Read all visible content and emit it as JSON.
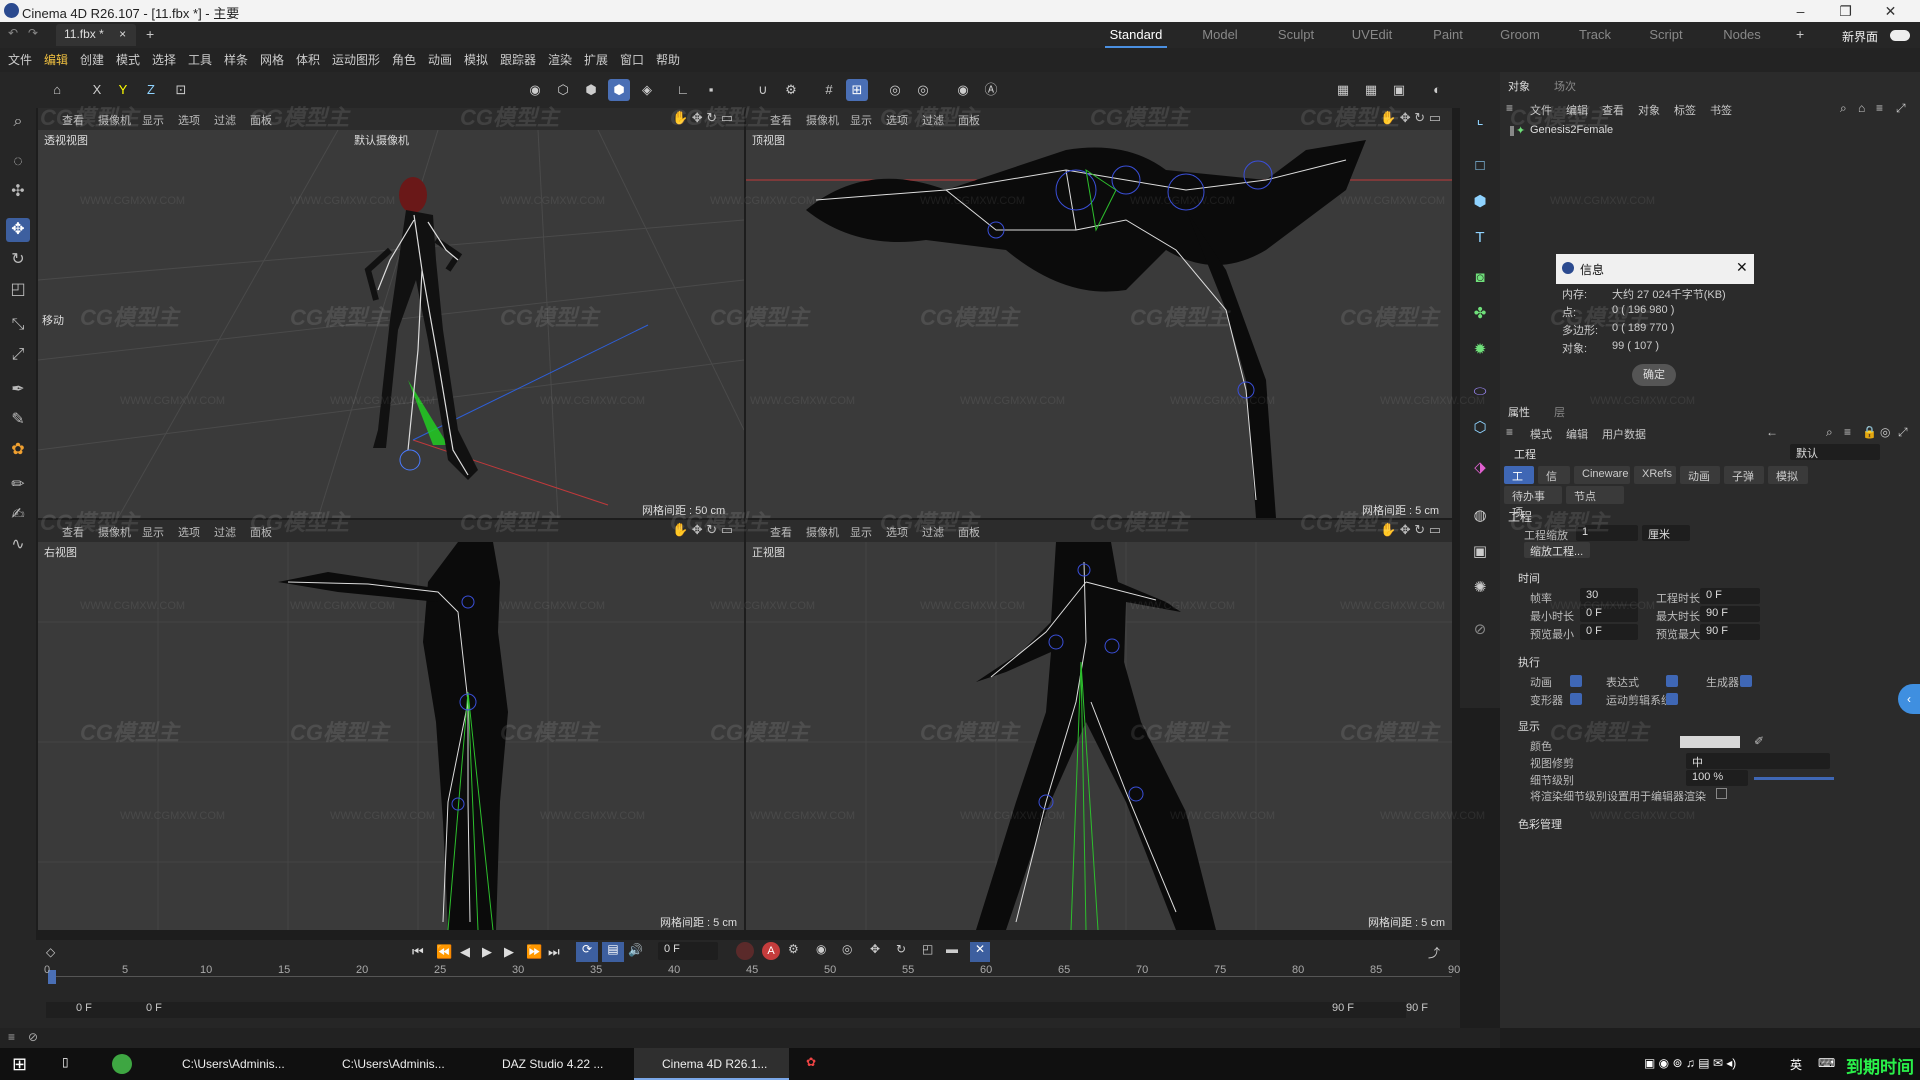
{
  "window": {
    "title": "Cinema 4D R26.107 - [11.fbx *] - 主要"
  },
  "doc_tab": {
    "label": "11.fbx *",
    "close": "×",
    "add": "+"
  },
  "layouts": [
    "Standard",
    "Model",
    "Sculpt",
    "UVEdit",
    "Paint",
    "Groom",
    "Track",
    "Script",
    "Nodes"
  ],
  "layout_active": "Standard",
  "layout_add": "+",
  "new_ui": "新界面",
  "menu": [
    "文件",
    "编辑",
    "创建",
    "模式",
    "选择",
    "工具",
    "样条",
    "网格",
    "体积",
    "运动图形",
    "角色",
    "动画",
    "模拟",
    "跟踪器",
    "渲染",
    "扩展",
    "窗口",
    "帮助"
  ],
  "toolbar_axes": [
    "X",
    "Y",
    "Z"
  ],
  "viewport_menu": [
    "查看",
    "摄像机",
    "显示",
    "选项",
    "过滤",
    "面板"
  ],
  "viewports": {
    "tl": {
      "name": "透视视图",
      "camera": "默认摄像机",
      "grid": "网格间距 : 50 cm",
      "move_label": "移动"
    },
    "tr": {
      "name": "顶视图",
      "grid": "网格间距 : 5 cm"
    },
    "bl": {
      "name": "右视图",
      "grid": "网格间距 : 5 cm"
    },
    "br": {
      "name": "正视图",
      "grid": "网格间距 : 5 cm"
    }
  },
  "watermark": {
    "logo": "CG模型主",
    "url": "WWW.CGMXW.COM"
  },
  "object_panel": {
    "tabs": [
      "对象",
      "场次"
    ],
    "menu": [
      "文件",
      "编辑",
      "查看",
      "对象",
      "标签",
      "书签"
    ],
    "object_name": "Genesis2Female"
  },
  "info_dialog": {
    "title": "信息",
    "rows": [
      {
        "label": "内存:",
        "value": "大约 27 024千字节(KB)"
      },
      {
        "label": "点:",
        "value": "0 ( 196 980 )"
      },
      {
        "label": "多边形:",
        "value": "0 ( 189 770 )"
      },
      {
        "label": "对象:",
        "value": "99 ( 107 )"
      }
    ],
    "ok": "确定"
  },
  "attr_panel": {
    "tabs": [
      "属性",
      "层"
    ],
    "menu": [
      "模式",
      "编辑",
      "用户数据"
    ],
    "context": "工程",
    "preset": "默认",
    "subtabs": [
      "工程",
      "信息",
      "Cineware",
      "XRefs",
      "动画",
      "子弹",
      "模拟"
    ],
    "subtabs2": [
      "待办事项",
      "节点"
    ],
    "section_title": "工程",
    "scale_label": "工程缩放",
    "scale_value": "1",
    "scale_unit": "厘米",
    "scale_btn": "缩放工程...",
    "time_section": "时间",
    "fps_label": "帧率",
    "fps": "30",
    "duration_label": "工程时长",
    "duration": "0 F",
    "min_label": "最小时长",
    "min": "0 F",
    "max_label": "最大时长",
    "max": "90 F",
    "pmin_label": "预览最小",
    "pmin": "0 F",
    "pmax_label": "预览最大",
    "pmax": "90 F",
    "exec_section": "执行",
    "exec": [
      "动画",
      "表达式",
      "生成器",
      "变形器",
      "运动剪辑系统"
    ],
    "display_section": "显示",
    "color_label": "颜色",
    "clip_label": "视图修剪",
    "clip_value": "中",
    "lod_label": "细节级别",
    "lod_value": "100 %",
    "lod_note": "将渲染细节级别设置用于编辑器渲染",
    "color_mgmt": "色彩管理"
  },
  "timeline": {
    "frame": "0 F",
    "ticks": [
      "0",
      "5",
      "10",
      "15",
      "20",
      "25",
      "30",
      "35",
      "40",
      "45",
      "50",
      "55",
      "60",
      "65",
      "70",
      "75",
      "80",
      "85",
      "90"
    ],
    "start": "0 F",
    "start2": "0 F",
    "end": "90 F",
    "end2": "90 F"
  },
  "taskbar": {
    "items": [
      "C:\\Users\\Adminis...",
      "C:\\Users\\Adminis...",
      "DAZ Studio 4.22 ...",
      "Cinema 4D R26.1..."
    ],
    "ime": "英",
    "brand": "到期时间"
  },
  "colors": {
    "accent": "#3f67b5",
    "bone": "#2dbf2d",
    "bg": "#3a3a3a"
  }
}
